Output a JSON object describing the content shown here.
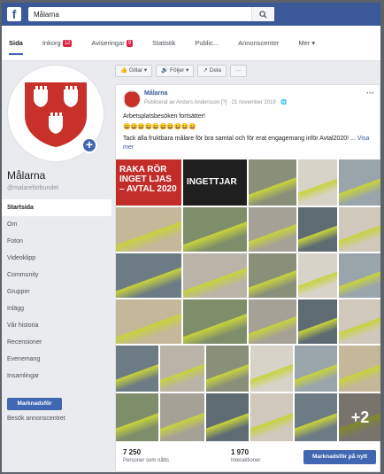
{
  "search": {
    "value": "Målarna"
  },
  "tabs": [
    {
      "label": "Sida",
      "active": true
    },
    {
      "label": "Inkorg",
      "badge": "12"
    },
    {
      "label": "Aviseringar",
      "badge": "9"
    },
    {
      "label": "Statistik"
    },
    {
      "label": "Public..."
    },
    {
      "label": "Annonscenter"
    },
    {
      "label": "Mer ▾"
    }
  ],
  "sidebar": {
    "page_name": "Målarna",
    "page_handle": "@malareforbundet",
    "items": [
      {
        "label": "Startsida",
        "active": true
      },
      {
        "label": "Om"
      },
      {
        "label": "Foton"
      },
      {
        "label": "Videoklipp"
      },
      {
        "label": "Community"
      },
      {
        "label": "Grupper"
      },
      {
        "label": "Inlägg"
      },
      {
        "label": "Vår historia"
      },
      {
        "label": "Recensioner"
      },
      {
        "label": "Evenemang"
      },
      {
        "label": "Insamlingar"
      }
    ],
    "promote_label": "Marknadsför",
    "visit_ads_label": "Besök annonscentret"
  },
  "actions": {
    "like": "👍 Gillar ▾",
    "follow": "🔊 Följer ▾",
    "share": "↗ Dela",
    "more": "···"
  },
  "post": {
    "author": "Målarna",
    "meta": "Publicerat av Anders Andersson [?] · 21 november 2019 · 🌐",
    "line1": "Arbetsplatsbesöken fortsätter!",
    "emoji": "😀😀😀😀😀😀😀😀😀😀",
    "line2": "Tack alla fruktbara målare för bra samtal och för erat engagemang inför Avtal2020! ...",
    "see_more": "Visa mer",
    "tile_text_1": "RAKA RÖR\nINGET LJAS\n– AVTAL 2020",
    "tile_text_2": "INGETTJAR",
    "plus_more": "+2"
  },
  "stats": {
    "reach_value": "7 250",
    "reach_label": "Personer som nåtts",
    "engagement_value": "1 970",
    "engagement_label": "Interaktioner",
    "boost_label": "Marknadsför på nytt"
  },
  "colors": {
    "brand_red": "#c8312a",
    "fb_blue": "#3b5998",
    "button_blue": "#4267b2"
  }
}
